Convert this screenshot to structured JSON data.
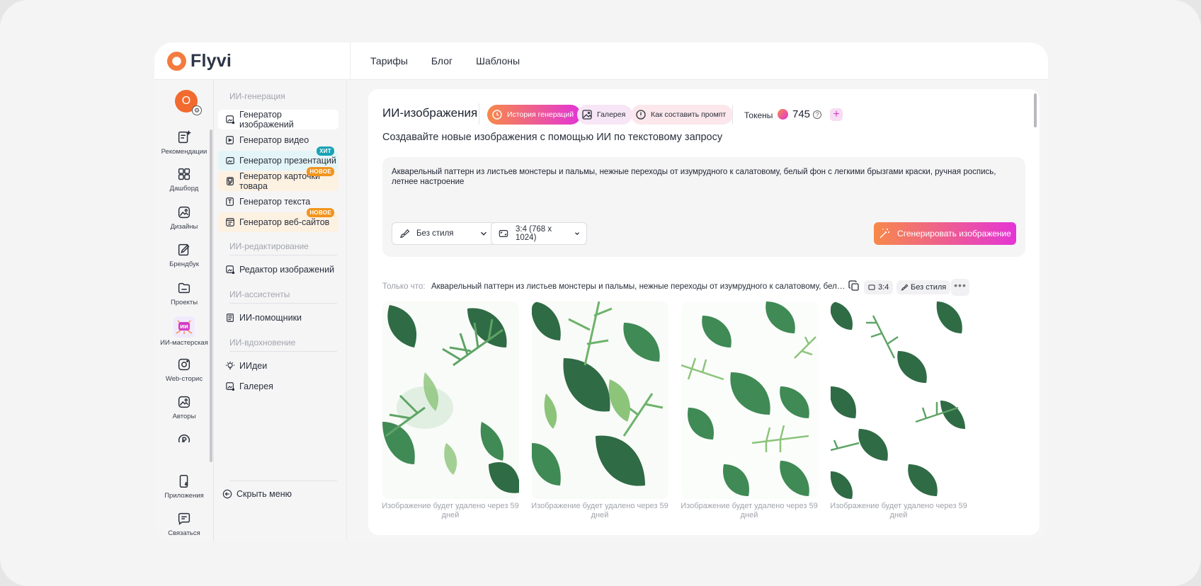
{
  "brand": {
    "name": "Flyvi"
  },
  "topnav": [
    "Тарифы",
    "Блог",
    "Шаблоны"
  ],
  "rail": {
    "avatar_letter": "О",
    "items": [
      "Рекомендации",
      "Дашборд",
      "Дизайны",
      "Брендбук",
      "Проекты",
      "ИИ-мастерская",
      "Web-сторис",
      "Авторы",
      "Приложения",
      "Связаться"
    ],
    "workshop_badge": "ИИ"
  },
  "menu": {
    "sections": [
      "ИИ-генерация",
      "ИИ-редактирование",
      "ИИ-ассистенты",
      "ИИ-вдохновение"
    ],
    "items": [
      "Генератор изображений",
      "Генератор видео",
      "Генератор презентаций",
      "Генератор карточки товара",
      "Генератор текста",
      "Генератор веб-сайтов",
      "Редактор изображений",
      "ИИ-помощники",
      "ИИдеи",
      "Галерея"
    ],
    "badge_hit": "ХИТ",
    "badge_new": "НОВОЕ",
    "hide": "Скрыть меню"
  },
  "main": {
    "title": "ИИ-изображения",
    "chips": [
      "История генераций",
      "Галерея",
      "Как составить промпт"
    ],
    "tokens_label": "Токены",
    "tokens_count": "745",
    "subtitle": "Создавайте новые изображения с помощью ИИ по текстовому запросу",
    "prompt": "Акварельный паттерн из листьев монстеры и пальмы, нежные переходы от изумрудного к салатовому, белый фон с легкими брызгами краски, ручная роспись, летнее настроение",
    "style_select": "Без стиля",
    "size_select": "3:4 (768 x 1024)",
    "generate": "Сгенерировать изображение",
    "recent_label": "Только что:",
    "recent_prompt": "Акварельный паттерн из листьев монстеры и пальмы, нежные переходы от изумрудного к салатовому, белый фон с легкими брызгами краски, ручная роспись, летнее настроение",
    "recent_ratio": "3:4",
    "recent_style": "Без стиля",
    "more": "•••",
    "caption": "Изображение будет удалено через 59 дней"
  },
  "colors": {
    "accent_start": "#f7894a",
    "accent_end": "#e434d6",
    "leaf_dark": "#2f6b45",
    "leaf_light": "#8cc47a"
  }
}
